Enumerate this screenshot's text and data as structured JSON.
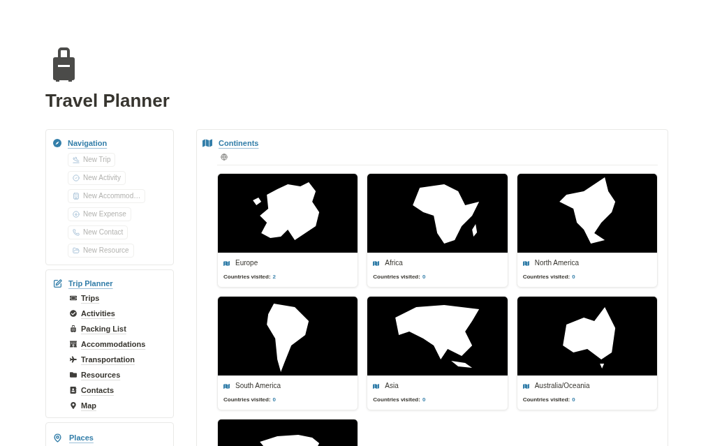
{
  "page": {
    "title": "Travel Planner"
  },
  "navigation": {
    "title": "Navigation",
    "buttons": [
      {
        "label": "New Trip",
        "disabled": true
      },
      {
        "label": "New Activity",
        "disabled": true
      },
      {
        "label": "New Accommod…",
        "disabled": true
      },
      {
        "label": "New Expense",
        "disabled": true
      },
      {
        "label": "New Contact",
        "disabled": true
      },
      {
        "label": "New Resource",
        "disabled": true
      }
    ]
  },
  "trip_planner": {
    "title": "Trip Planner",
    "items": [
      "Trips",
      "Activities",
      "Packing List",
      "Accommodations",
      "Transportation",
      "Resources",
      "Contacts",
      "Map"
    ]
  },
  "places": {
    "title": "Places"
  },
  "continents": {
    "title": "Continents",
    "cards": [
      {
        "kind": "full",
        "name": "Europe",
        "visited_label": "Countries visited:",
        "visited_count": "2"
      },
      {
        "kind": "full",
        "name": "Africa",
        "visited_label": "Countries visited:",
        "visited_count": "0"
      },
      {
        "kind": "full",
        "name": "North America",
        "visited_label": "Countries visited:",
        "visited_count": "0"
      },
      {
        "kind": "full",
        "name": "South America",
        "visited_label": "Countries visited:",
        "visited_count": "0"
      },
      {
        "kind": "full",
        "name": "Asia",
        "visited_label": "Countries visited:",
        "visited_count": "0"
      },
      {
        "kind": "full",
        "name": "Australia/Oceania",
        "visited_label": "Countries visited:",
        "visited_count": "0"
      },
      {
        "kind": "cut"
      }
    ]
  }
}
